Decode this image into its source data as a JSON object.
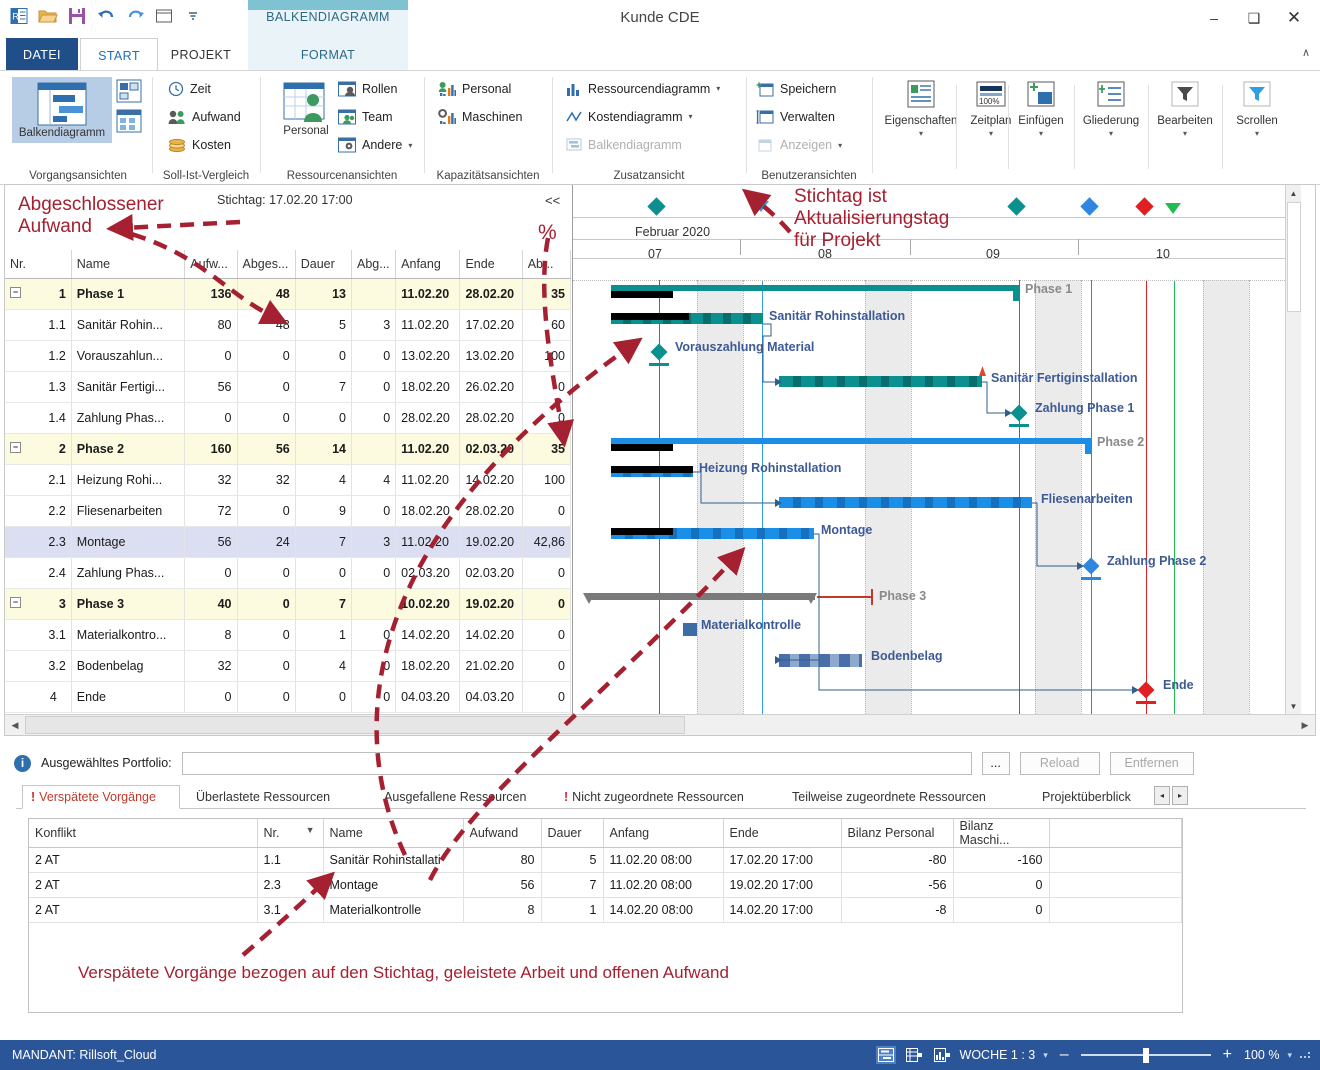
{
  "window": {
    "title": "Kunde CDE",
    "contextual_tab": "BALKENDIAGRAMM",
    "minimize": "–",
    "maximize": "❑",
    "close": "✕",
    "collapse_ribbon": "∧"
  },
  "quick_access": [
    "app-icon",
    "open-icon",
    "save-icon",
    "undo-icon",
    "redo-icon",
    "window-icon",
    "more-icon"
  ],
  "tabs": [
    {
      "label": "DATEI",
      "type": "file"
    },
    {
      "label": "START",
      "type": "selected"
    },
    {
      "label": "PROJEKT",
      "type": "normal"
    },
    {
      "label": "FORMAT",
      "type": "contextual"
    }
  ],
  "ribbon": {
    "groups": [
      {
        "title": "Vorgangsansichten",
        "big_button": {
          "label": "Balkendiagramm",
          "icon": "gantt-icon"
        },
        "side_icons": [
          "network-icon",
          "table-icon"
        ]
      },
      {
        "title": "Soll-Ist-Vergleich",
        "items": [
          {
            "label": "Zeit",
            "icon": "clock-icon"
          },
          {
            "label": "Aufwand",
            "icon": "people-icon"
          },
          {
            "label": "Kosten",
            "icon": "coins-icon"
          }
        ]
      },
      {
        "title": "Ressourcenansichten",
        "big_button": {
          "label": "Personal",
          "icon": "personal-icon"
        },
        "items": [
          {
            "label": "Rollen",
            "icon": "roles-icon"
          },
          {
            "label": "Team",
            "icon": "team-icon"
          },
          {
            "label": "Andere",
            "icon": "other-icon",
            "caret": "▾"
          }
        ]
      },
      {
        "title": "Kapazitätsansichten",
        "items": [
          {
            "label": "Personal",
            "icon": "capacity-person-icon"
          },
          {
            "label": "Maschinen",
            "icon": "capacity-machine-icon"
          }
        ]
      },
      {
        "title": "Zusatzansicht",
        "items": [
          {
            "label": "Ressourcendiagramm",
            "icon": "bars-icon",
            "caret": "▾"
          },
          {
            "label": "Kostendiagramm",
            "icon": "linechart-icon",
            "caret": "▾"
          },
          {
            "label": "Balkendiagramm",
            "icon": "gantt-small-icon",
            "disabled": true
          }
        ]
      },
      {
        "title": "Benutzeransichten",
        "items": [
          {
            "label": "Speichern",
            "icon": "save-view-icon"
          },
          {
            "label": "Verwalten",
            "icon": "manage-view-icon"
          },
          {
            "label": "Anzeigen",
            "icon": "show-view-icon",
            "caret": "▾",
            "disabled": true
          }
        ]
      }
    ],
    "command_buttons": [
      {
        "label": "Eigenschaften",
        "icon": "properties-icon",
        "caret": "▾"
      },
      {
        "label": "Zeitplan",
        "icon": "schedule-icon",
        "caret": "▾"
      },
      {
        "label": "Einfügen",
        "icon": "insert-icon",
        "caret": "▾"
      },
      {
        "label": "Gliederung",
        "icon": "outline-icon",
        "caret": "▾"
      },
      {
        "label": "Bearbeiten",
        "icon": "filter-icon",
        "caret": "▾"
      },
      {
        "label": "Scrollen",
        "icon": "scroll-icon",
        "caret": "▾"
      }
    ]
  },
  "grid": {
    "stichtag_label": "Stichtag: 17.02.20 17:00",
    "collapse_button": "<<",
    "columns": [
      "Nr.",
      "Name",
      "Aufw...",
      "Abges...",
      "Dauer",
      "Abg...",
      "Anfang",
      "Ende",
      "Ab..."
    ],
    "rows": [
      {
        "nr": "1",
        "name": "Phase 1",
        "aufwand": "136",
        "abges": "48",
        "dauer": "13",
        "abg": "",
        "anfang": "11.02.20",
        "ende": "28.02.20",
        "abp": "35",
        "kind": "phase",
        "expander": "−"
      },
      {
        "nr": "1.1",
        "name": "Sanitär Rohin...",
        "aufwand": "80",
        "abges": "48",
        "dauer": "5",
        "abg": "3",
        "anfang": "11.02.20",
        "ende": "17.02.20",
        "abp": "60",
        "kind": "task"
      },
      {
        "nr": "1.2",
        "name": "Vorauszahlun...",
        "aufwand": "0",
        "abges": "0",
        "dauer": "0",
        "abg": "0",
        "anfang": "13.02.20",
        "ende": "13.02.20",
        "abp": "100",
        "kind": "task"
      },
      {
        "nr": "1.3",
        "name": "Sanitär Fertigi...",
        "aufwand": "56",
        "abges": "0",
        "dauer": "7",
        "abg": "0",
        "anfang": "18.02.20",
        "ende": "26.02.20",
        "abp": "0",
        "kind": "task"
      },
      {
        "nr": "1.4",
        "name": "Zahlung Phas...",
        "aufwand": "0",
        "abges": "0",
        "dauer": "0",
        "abg": "0",
        "anfang": "28.02.20",
        "ende": "28.02.20",
        "abp": "0",
        "kind": "task"
      },
      {
        "nr": "2",
        "name": "Phase 2",
        "aufwand": "160",
        "abges": "56",
        "dauer": "14",
        "abg": "",
        "anfang": "11.02.20",
        "ende": "02.03.20",
        "abp": "35",
        "kind": "phase",
        "expander": "−"
      },
      {
        "nr": "2.1",
        "name": "Heizung Rohi...",
        "aufwand": "32",
        "abges": "32",
        "dauer": "4",
        "abg": "4",
        "anfang": "11.02.20",
        "ende": "14.02.20",
        "abp": "100",
        "kind": "task"
      },
      {
        "nr": "2.2",
        "name": "Fliesenarbeiten",
        "aufwand": "72",
        "abges": "0",
        "dauer": "9",
        "abg": "0",
        "anfang": "18.02.20",
        "ende": "28.02.20",
        "abp": "0",
        "kind": "task"
      },
      {
        "nr": "2.3",
        "name": "Montage",
        "aufwand": "56",
        "abges": "24",
        "dauer": "7",
        "abg": "3",
        "anfang": "11.02.20",
        "ende": "19.02.20",
        "abp": "42,86",
        "kind": "selected"
      },
      {
        "nr": "2.4",
        "name": "Zahlung Phas...",
        "aufwand": "0",
        "abges": "0",
        "dauer": "0",
        "abg": "0",
        "anfang": "02.03.20",
        "ende": "02.03.20",
        "abp": "0",
        "kind": "task"
      },
      {
        "nr": "3",
        "name": "Phase 3",
        "aufwand": "40",
        "abges": "0",
        "dauer": "7",
        "abg": "",
        "anfang": "10.02.20",
        "ende": "19.02.20",
        "abp": "0",
        "kind": "phase",
        "expander": "−"
      },
      {
        "nr": "3.1",
        "name": "Materialkontro...",
        "aufwand": "8",
        "abges": "0",
        "dauer": "1",
        "abg": "0",
        "anfang": "14.02.20",
        "ende": "14.02.20",
        "abp": "0",
        "kind": "task"
      },
      {
        "nr": "3.2",
        "name": "Bodenbelag",
        "aufwand": "32",
        "abges": "0",
        "dauer": "4",
        "abg": "0",
        "anfang": "18.02.20",
        "ende": "21.02.20",
        "abp": "0",
        "kind": "task"
      },
      {
        "nr": "4",
        "name": "Ende",
        "aufwand": "0",
        "abges": "0",
        "dauer": "0",
        "abg": "0",
        "anfang": "04.03.20",
        "ende": "04.03.20",
        "abp": "0",
        "kind": "task"
      }
    ]
  },
  "gantt": {
    "month_label": "Februar 2020",
    "week_labels": [
      "07",
      "08",
      "09",
      "10"
    ],
    "bar_labels": [
      "Phase 1",
      "Sanitär Rohinstallation",
      "Vorauszahlung Material",
      "Sanitär Fertiginstallation",
      "Zahlung Phase 1",
      "Phase 2",
      "Heizung Rohinstallation",
      "Fliesenarbeiten",
      "Montage",
      "Zahlung Phase 2",
      "Phase 3",
      "Materialkontrolle",
      "Bodenbelag",
      "Ende"
    ],
    "colors": {
      "phase1": "#0b8f8f",
      "phase2": "#1b8fe8",
      "phase3": "#7a7a7a",
      "bodenbelag": "#4a6ea8",
      "today_line": "#1b8fe8",
      "deadline_red": "#e02020",
      "green": "#22bb55"
    }
  },
  "lower": {
    "portfolio_label": "Ausgewähltes Portfolio:",
    "portfolio_value": "",
    "browse_button": "...",
    "reload_button": "Reload",
    "remove_button": "Entfernen",
    "tabs": [
      {
        "label": "Verspätete Vorgänge",
        "warn": true,
        "active": true
      },
      {
        "label": "Überlastete Ressourcen",
        "warn": false,
        "active": false
      },
      {
        "label": "Ausgefallene Ressourcen",
        "warn": false,
        "active": false
      },
      {
        "label": "Nicht zugeordnete Ressourcen",
        "warn": true,
        "active": false
      },
      {
        "label": "Teilweise zugeordnete Ressourcen",
        "warn": false,
        "active": false
      },
      {
        "label": "Projektüberblick",
        "warn": false,
        "active": false
      }
    ],
    "nav_prev": "◂",
    "nav_next": "▸",
    "table": {
      "columns": [
        "Konflikt",
        "Nr.",
        "Name",
        "Aufwand",
        "Dauer",
        "Anfang",
        "Ende",
        "Bilanz Personal",
        "Bilanz Maschi...",
        ""
      ],
      "sort_indicator": "▼",
      "rows": [
        {
          "konflikt": "2 AT",
          "nr": "1.1",
          "name": "Sanitär Rohinstallati",
          "aufwand": "80",
          "dauer": "5",
          "anfang": "11.02.20 08:00",
          "ende": "17.02.20 17:00",
          "bilanz_personal": "-80",
          "bilanz_maschinen": "-160"
        },
        {
          "konflikt": "2 AT",
          "nr": "2.3",
          "name": "Montage",
          "aufwand": "56",
          "dauer": "7",
          "anfang": "11.02.20 08:00",
          "ende": "19.02.20 17:00",
          "bilanz_personal": "-56",
          "bilanz_maschinen": "0"
        },
        {
          "konflikt": "2 AT",
          "nr": "3.1",
          "name": "Materialkontrolle",
          "aufwand": "8",
          "dauer": "1",
          "anfang": "14.02.20 08:00",
          "ende": "14.02.20 17:00",
          "bilanz_personal": "-8",
          "bilanz_maschinen": "0"
        }
      ]
    }
  },
  "statusbar": {
    "mandant": "MANDANT: Rillsoft_Cloud",
    "view_buttons": [
      "split-view-icon",
      "table-view-icon",
      "chart-view-icon"
    ],
    "scale": "WOCHE 1 : 3",
    "scale_caret": "▾",
    "zoom_out": "–",
    "zoom_in": "+",
    "zoom_value": "100 %",
    "zoom_caret": "▾",
    "resize_grip": "grip-icon"
  },
  "annotations": {
    "a1": "Abgeschlossener\nAufwand",
    "a2": "%",
    "a3": "Stichtag ist\nAktualisierungstag\nfür Projekt",
    "a4": "Verspätete Vorgänge bezogen auf den Stichtag, geleistete Arbeit und offenen Aufwand",
    "color": "#a52030"
  }
}
